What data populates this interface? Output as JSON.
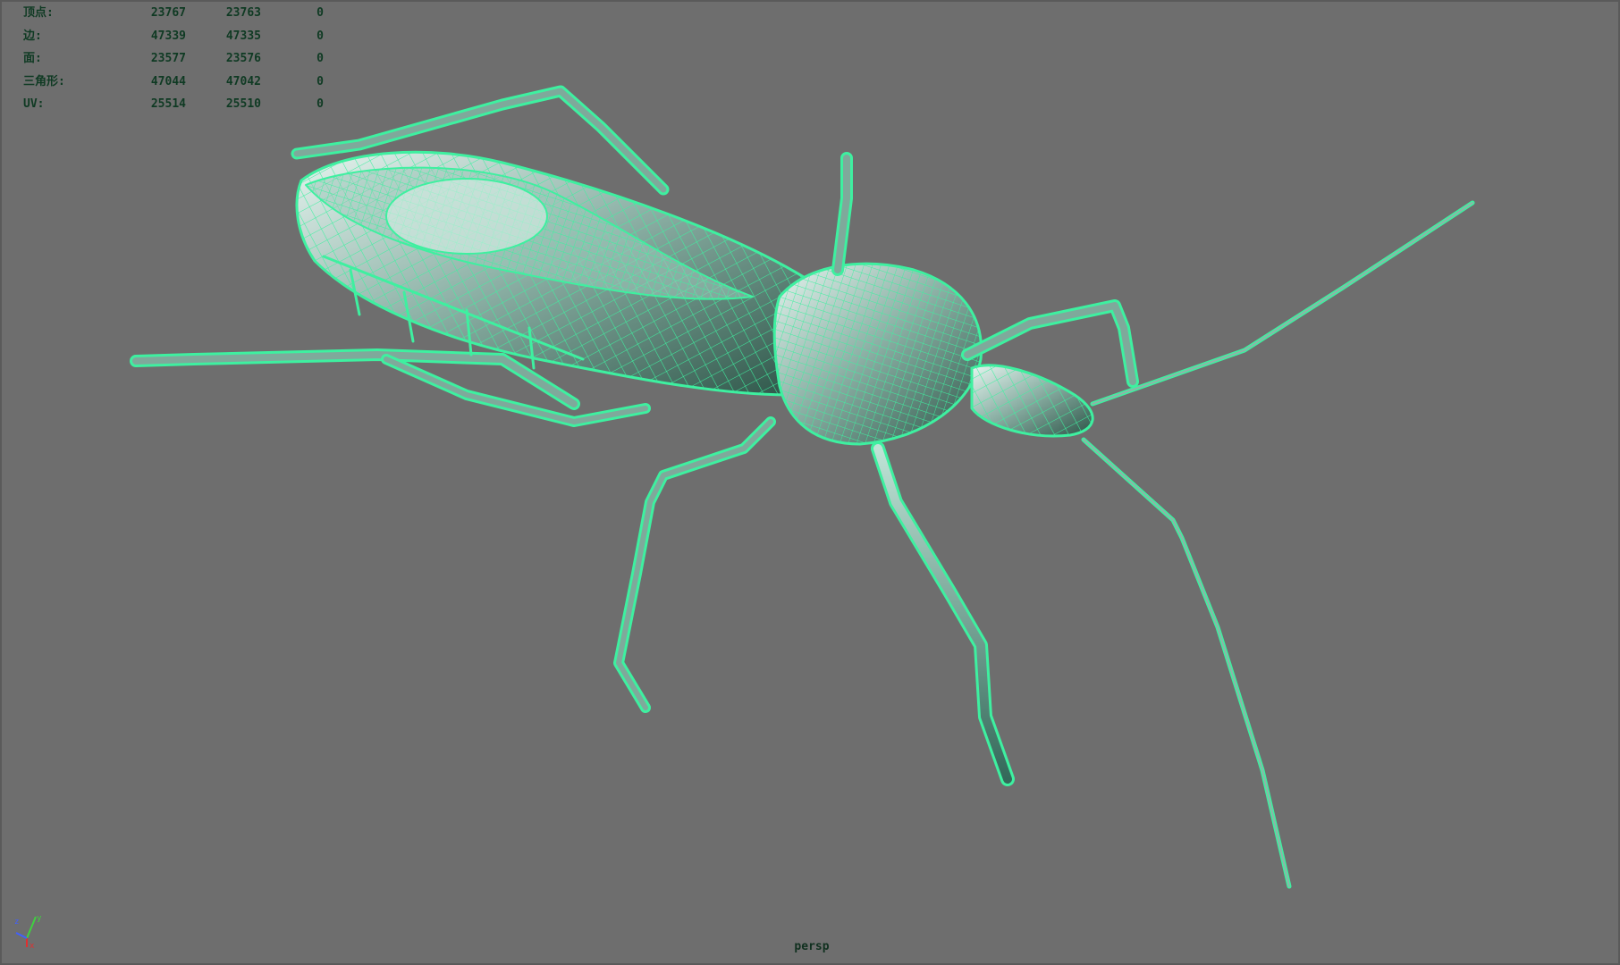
{
  "stats": {
    "rows": [
      {
        "label": "顶点:",
        "a": "23767",
        "b": "23763",
        "c": "0"
      },
      {
        "label": "边:",
        "a": "47339",
        "b": "47335",
        "c": "0"
      },
      {
        "label": "面:",
        "a": "23577",
        "b": "23576",
        "c": "0"
      },
      {
        "label": "三角形:",
        "a": "47044",
        "b": "47042",
        "c": "0"
      },
      {
        "label": "UV:",
        "a": "25514",
        "b": "25510",
        "c": "0"
      }
    ]
  },
  "viewport": {
    "camera": "persp",
    "background_color": "#6e6e6e",
    "wire_color": "#3ef0a0"
  },
  "axis": {
    "x_color": "#e03030",
    "y_color": "#40d040",
    "z_color": "#4060ff"
  }
}
